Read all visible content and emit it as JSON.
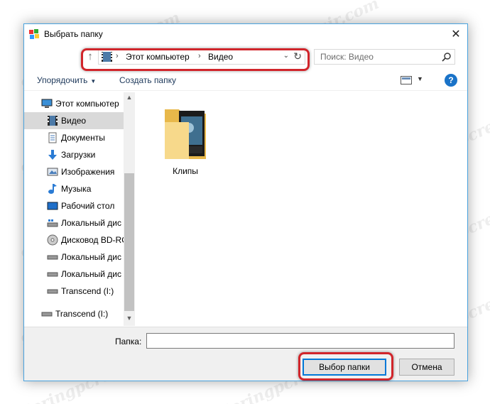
{
  "window": {
    "title": "Выбрать папку",
    "close_glyph": "✕"
  },
  "address": {
    "up_glyph": "↑",
    "breadcrumbs": [
      "Этот компьютер",
      "Видео"
    ],
    "separator": "›",
    "dropdown_glyph": "⌄",
    "refresh_glyph": "↻"
  },
  "search": {
    "placeholder": "Поиск: Видео"
  },
  "toolbar": {
    "organize_label": "Упорядочить",
    "new_folder_label": "Создать папку",
    "caret": "▼",
    "help_glyph": "?"
  },
  "sidebar": {
    "items": [
      {
        "label": "Этот компьютер",
        "icon": "computer-icon"
      },
      {
        "label": "Видео",
        "icon": "video-folder-icon",
        "selected": true
      },
      {
        "label": "Документы",
        "icon": "documents-icon"
      },
      {
        "label": "Загрузки",
        "icon": "downloads-icon"
      },
      {
        "label": "Изображения",
        "icon": "pictures-icon"
      },
      {
        "label": "Музыка",
        "icon": "music-icon"
      },
      {
        "label": "Рабочий стол",
        "icon": "desktop-icon"
      },
      {
        "label": "Локальный дис",
        "icon": "local-disk-icon"
      },
      {
        "label": "Дисковод BD-RC",
        "icon": "optical-drive-icon"
      },
      {
        "label": "Локальный дис",
        "icon": "drive-icon"
      },
      {
        "label": "Локальный дис",
        "icon": "drive-icon"
      },
      {
        "label": "Transcend (I:)",
        "icon": "drive-icon"
      },
      {
        "label": "Transcend (I:)",
        "icon": "drive-icon"
      }
    ],
    "scroll_up": "▲",
    "scroll_down": "▼"
  },
  "content": {
    "items": [
      {
        "label": "Клипы",
        "type": "folder"
      }
    ]
  },
  "footer": {
    "folder_label": "Папка:",
    "folder_value": "",
    "select_button": "Выбор папки",
    "cancel_button": "Отмена"
  },
  "colors": {
    "accent": "#0078d7",
    "highlight": "#d1252b",
    "selected_bg": "#d9d9d9",
    "help_blue": "#1a73c8"
  },
  "watermark": "Soringpcrepair.com"
}
